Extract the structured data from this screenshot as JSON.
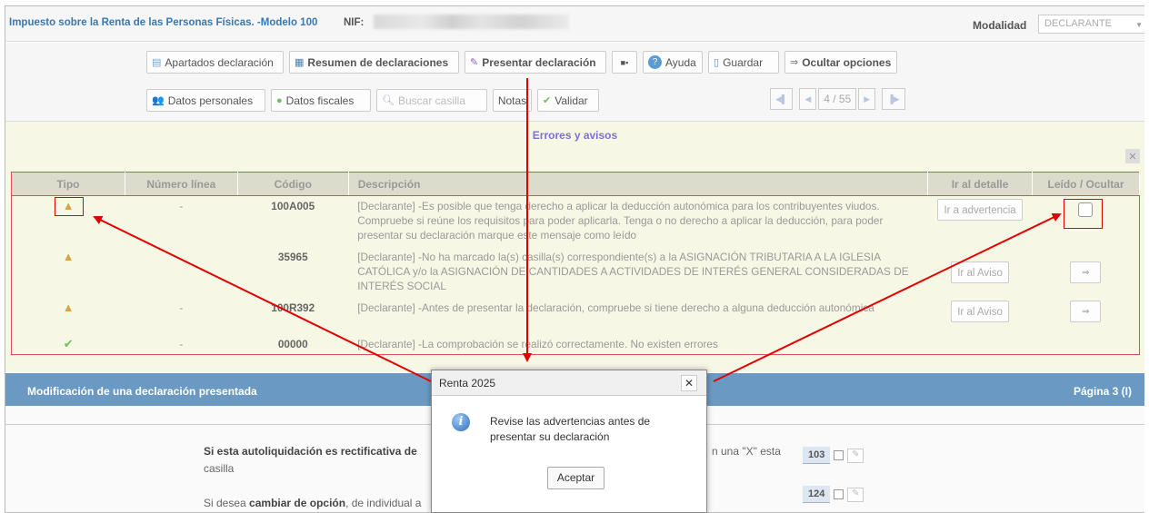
{
  "header": {
    "title": "Impuesto sobre la Renta de las Personas Físicas. -Modelo 100",
    "nif_label": "NIF:",
    "modalidad_label": "Modalidad",
    "modalidad_value": "DECLARANTE"
  },
  "toolbar": {
    "row1": [
      {
        "label": "Apartados declaración",
        "icon": "table-icon"
      },
      {
        "label": "Resumen de declaraciones",
        "icon": "summary-icon"
      },
      {
        "label": "Presentar declaración",
        "icon": "present-icon"
      },
      {
        "label": "",
        "icon": "more-icon"
      },
      {
        "label": "Ayuda",
        "icon": "help-icon"
      },
      {
        "label": "Guardar",
        "icon": "save-icon"
      },
      {
        "label": "Ocultar opciones",
        "icon": "hide-icon"
      }
    ],
    "row2": [
      {
        "label": "Datos personales",
        "icon": "people-icon"
      },
      {
        "label": "Datos fiscales",
        "icon": "fiscal-icon"
      },
      {
        "label": "Buscar casilla",
        "icon": "search-icon"
      },
      {
        "label": "Notas",
        "icon": ""
      },
      {
        "label": "Validar",
        "icon": "check-icon"
      }
    ],
    "page_indicator": "4 / 55"
  },
  "errors": {
    "title": "Errores y avisos",
    "columns": [
      "Tipo",
      "Número línea",
      "Código",
      "Descripción",
      "Ir al detalle",
      "Leído / Ocultar"
    ],
    "rows": [
      {
        "tipo": "warning",
        "linea": "-",
        "codigo": "100A005",
        "descripcion": "[Declarante] -Es posible que tenga derecho a aplicar la deducción autonómica para los contribuyentes viudos. Compruebe si reúne los requisitos para poder aplicarla. Tenga o no derecho a aplicar la deducción, para poder presentar su declaración marque este mensaje como leído",
        "detalle": "Ir a advertencia",
        "accion": "checkbox"
      },
      {
        "tipo": "warning",
        "linea": "",
        "codigo": "35965",
        "descripcion": "[Declarante] -No ha marcado la(s) casilla(s) correspondiente(s) a la ASIGNACIÓN TRIBUTARIA A LA IGLESIA CATÓLICA y/o la ASIGNACIÓN DE CANTIDADES A ACTIVIDADES DE INTERÉS GENERAL CONSIDERADAS DE INTERÉS SOCIAL",
        "detalle": "Ir al Aviso",
        "accion": "hide"
      },
      {
        "tipo": "warning",
        "linea": "-",
        "codigo": "100R392",
        "descripcion": "[Declarante] -Antes de presentar la declaración, compruebe si tiene derecho a alguna deducción autonómica",
        "detalle": "Ir al Aviso",
        "accion": "hide"
      },
      {
        "tipo": "ok",
        "linea": "-",
        "codigo": "00000",
        "descripcion": "[Declarante] -La comprobación se realizó correctamente. No existen errores",
        "detalle": "",
        "accion": ""
      }
    ]
  },
  "section": {
    "title": "Modificación de una declaración presentada",
    "page": "Página 3 (I)"
  },
  "form": {
    "q1_bold": "Si esta autoliquidación es rectificativa de",
    "q1_rest": "n una \"X\" esta",
    "q1_line2": "casilla",
    "q1_casilla": "103",
    "q2_pre": "Si desea",
    "q2_bold": "cambiar de opción",
    "q2_rest": ", de individual a",
    "q2_casilla": "124"
  },
  "dialog": {
    "title": "Renta 2025",
    "message": "Revise las advertencias antes de presentar su declaración",
    "ok_label": "Aceptar"
  },
  "colors": {
    "accent_blue": "#3b78ad",
    "section_blue": "#6a9ac3",
    "highlight_red": "#e00000",
    "warning_bg": "#f7f7e6",
    "errors_title": "#7e6fd6"
  }
}
